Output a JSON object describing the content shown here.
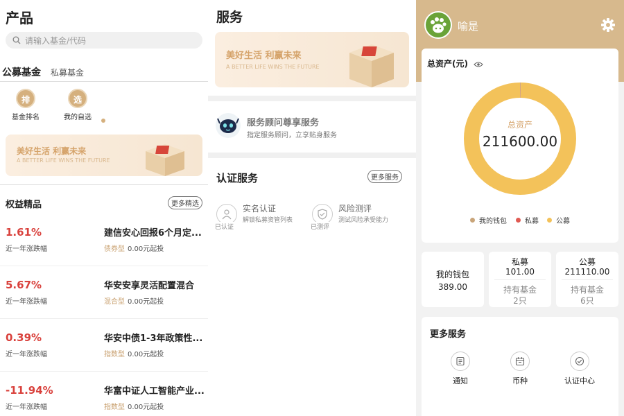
{
  "products": {
    "title": "产品",
    "search_placeholder": "请输入基金/代码",
    "tabs": [
      "公募基金",
      "私募基金"
    ],
    "quick": [
      {
        "glyph": "排",
        "label": "基金排名"
      },
      {
        "glyph": "选",
        "label": "我的自选"
      }
    ],
    "banner": {
      "title": "美好生活 利赢未来",
      "subtitle": "A BETTER LIFE WINS THE FUTURE"
    },
    "section_title": "权益精品",
    "more_label": "更多精选",
    "funds": [
      {
        "pct": "1.61%",
        "sub": "近一年涨跌幅",
        "name": "建信安心回报6个月定...",
        "tag": "债券型",
        "min": "0.00元起投"
      },
      {
        "pct": "5.67%",
        "sub": "近一年涨跌幅",
        "name": "华安安享灵活配置混合",
        "tag": "混合型",
        "min": "0.00元起投"
      },
      {
        "pct": "0.39%",
        "sub": "近一年涨跌幅",
        "name": "华安中债1-3年政策性...",
        "tag": "指数型",
        "min": "0.00元起投"
      },
      {
        "pct": "-11.94%",
        "sub": "近一年涨跌幅",
        "name": "华富中证人工智能产业...",
        "tag": "指数型",
        "min": "0.00元起投"
      }
    ]
  },
  "services": {
    "title": "服务",
    "banner": {
      "title": "美好生活 利赢未来",
      "subtitle": "A BETTER LIFE WINS THE FUTURE"
    },
    "advisor": {
      "name": "服务顾问尊享服务",
      "desc": "指定服务顾问，立享贴身服务"
    },
    "cert_title": "认证服务",
    "more_label": "更多服务",
    "cert_items": [
      {
        "name": "实名认证",
        "desc": "解锁私募资管列表",
        "status": "已认证"
      },
      {
        "name": "风险测评",
        "desc": "测试风险承受能力",
        "status": "已测评"
      }
    ]
  },
  "account": {
    "username": "喻是",
    "assets_title": "总资产(元)",
    "donut_label": "总资产",
    "total": "211600.00",
    "legend": [
      {
        "label": "我的钱包",
        "color": "#c9a57a"
      },
      {
        "label": "私募",
        "color": "#e05a52"
      },
      {
        "label": "公募",
        "color": "#f3c25a"
      }
    ],
    "wallet": {
      "label": "我的钱包",
      "value": "389.00"
    },
    "private": {
      "label": "私募",
      "value": "101.00",
      "hold_label": "持有基金",
      "count": "2只"
    },
    "public": {
      "label": "公募",
      "value": "211110.00",
      "hold_label": "持有基金",
      "count": "6只"
    },
    "more_services_title": "更多服务",
    "more_services": [
      "通知",
      "币种",
      "认证中心"
    ]
  },
  "chart_data": {
    "type": "pie",
    "categories": [
      "我的钱包",
      "私募",
      "公募"
    ],
    "values": [
      389.0,
      101.0,
      211110.0
    ],
    "title": "总资产"
  }
}
